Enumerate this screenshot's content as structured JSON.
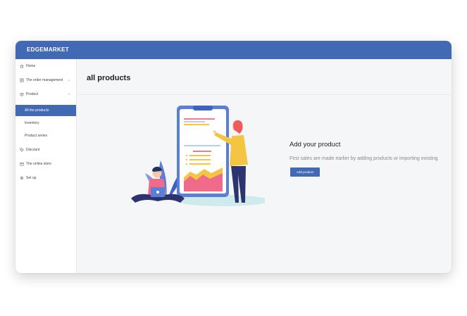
{
  "app": {
    "brand": "EDGEMARKET"
  },
  "sidebar": {
    "items": [
      {
        "label": "Home",
        "icon": "home-icon"
      },
      {
        "label": "The order management",
        "icon": "order-icon"
      },
      {
        "label": "Product",
        "icon": "product-icon",
        "expanded": true,
        "children": [
          {
            "label": "All the products",
            "active": true
          },
          {
            "label": "Inventory"
          },
          {
            "label": "Product series"
          }
        ]
      },
      {
        "label": "Discount",
        "icon": "tag-icon"
      },
      {
        "label": "The online store",
        "icon": "store-icon"
      },
      {
        "label": "Set up",
        "icon": "gear-icon"
      }
    ]
  },
  "main": {
    "title": "all products",
    "empty_state": {
      "heading": "Add your product",
      "description": "First sales are made earlier by adding products or importing existing",
      "button_label": "Add product"
    }
  },
  "colors": {
    "brand": "#4169b4",
    "background": "#f5f6f8",
    "accent_yellow": "#f4c542",
    "accent_pink": "#f06a8a"
  }
}
